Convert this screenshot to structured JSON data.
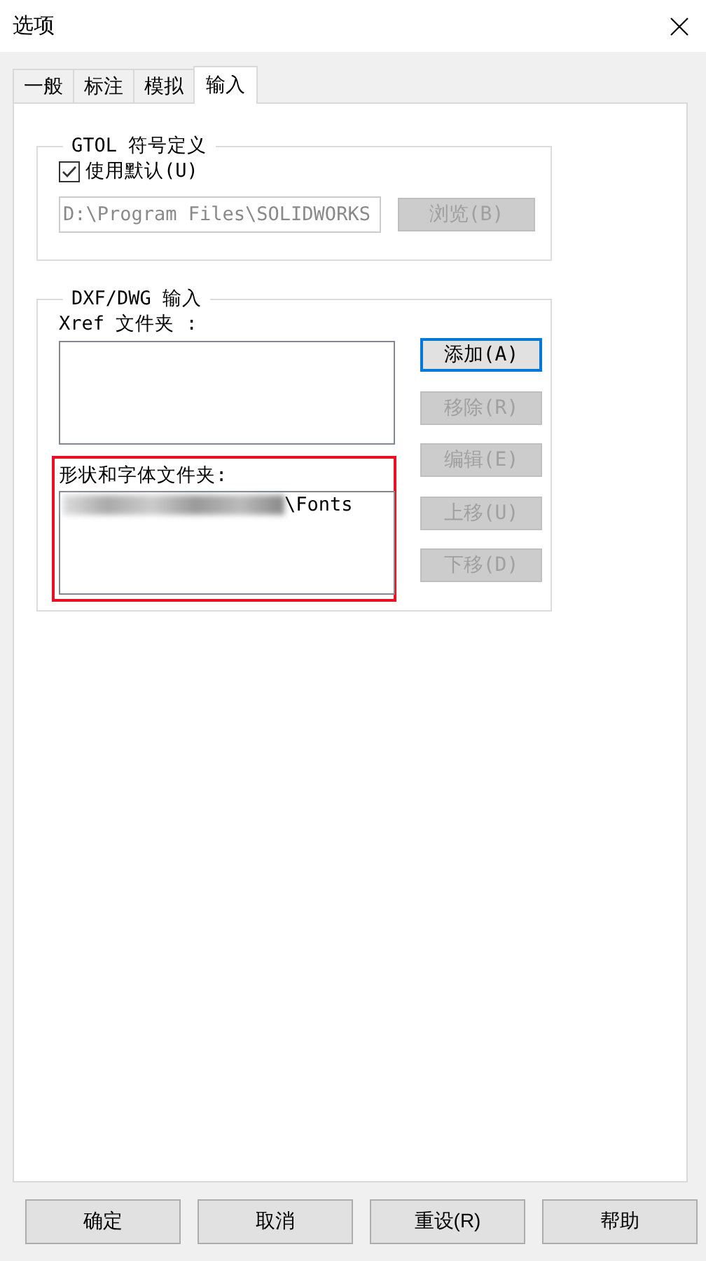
{
  "window": {
    "title": "选项"
  },
  "tabs": [
    {
      "label": "一般",
      "selected": false
    },
    {
      "label": "标注",
      "selected": false
    },
    {
      "label": "模拟",
      "selected": false
    },
    {
      "label": "输入",
      "selected": true
    }
  ],
  "gtol": {
    "title": "GTOL 符号定义",
    "use_default": {
      "label": "使用默认(U)",
      "checked": true
    },
    "path": {
      "value": "D:\\Program Files\\SOLIDWORKS",
      "disabled": true
    },
    "browse": {
      "label": "浏览(B)",
      "disabled": true
    }
  },
  "dxf": {
    "title": "DXF/DWG 输入",
    "xref_label": "Xref 文件夹 :",
    "shape_label": "形状和字体文件夹:",
    "shape_highlighted": true,
    "shape_items": [
      {
        "text": "\\Fonts",
        "redacted": true
      }
    ],
    "buttons": [
      {
        "label": "添加(A)",
        "disabled": false,
        "focused": true
      },
      {
        "label": "移除(R)",
        "disabled": true,
        "focused": false
      },
      {
        "label": "编辑(E)",
        "disabled": true,
        "focused": false
      },
      {
        "label": "上移(U)",
        "disabled": true,
        "focused": false
      },
      {
        "label": "下移(D)",
        "disabled": true,
        "focused": false
      }
    ]
  },
  "buttons": [
    "确定",
    "取消",
    "重设(R)",
    "帮助"
  ]
}
